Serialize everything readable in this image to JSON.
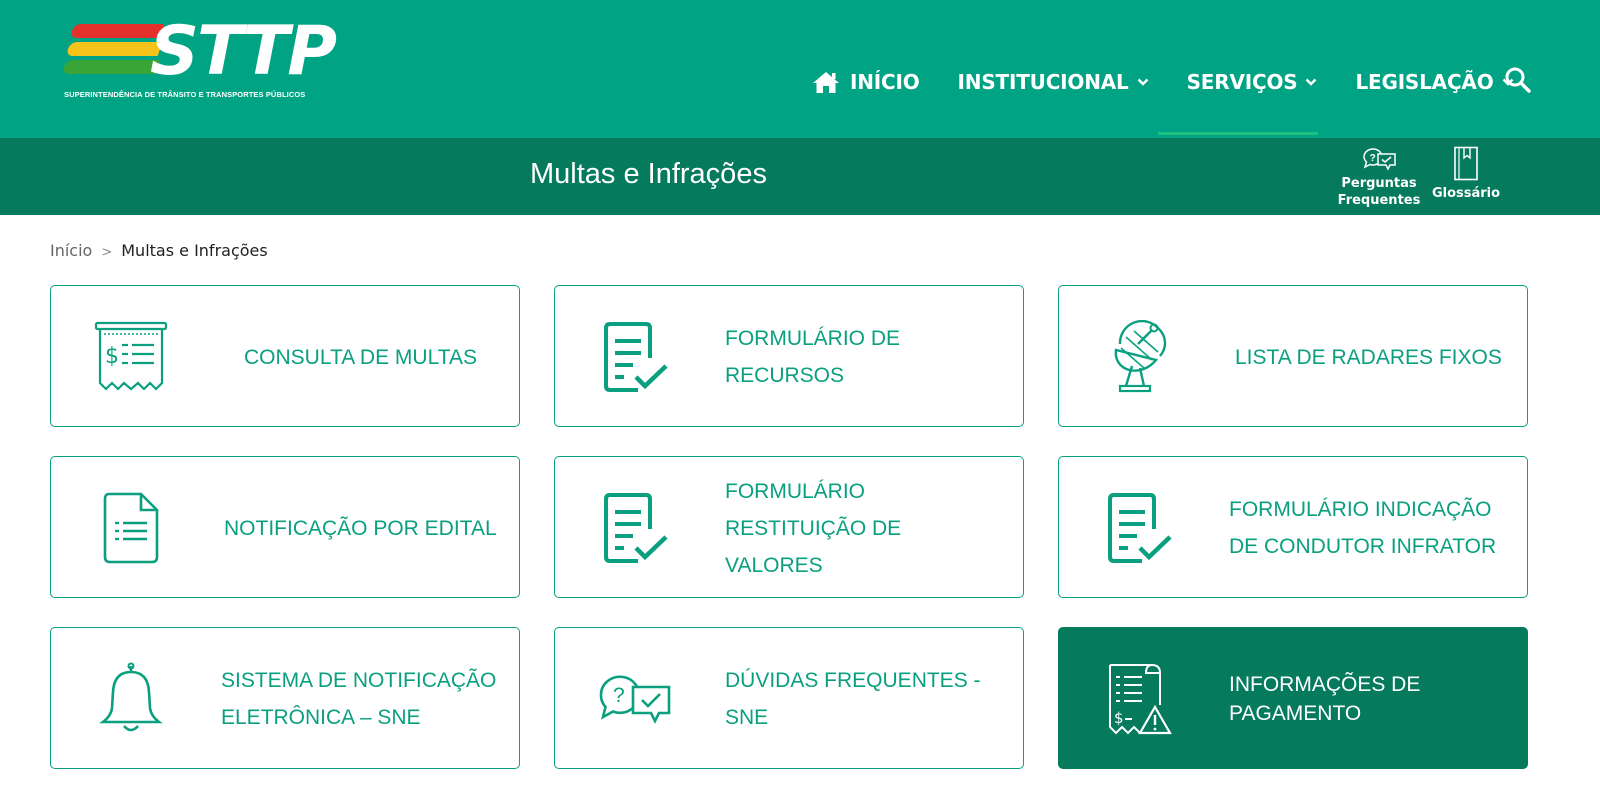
{
  "brand": {
    "logo_text": "STTP",
    "tagline": "SUPERINTENDÊNCIA DE TRÂNSITO E TRANSPORTES PÚBLICOS",
    "colors": {
      "primary": "#00a383",
      "dark": "#057a5d",
      "logo_red": "#e5312b",
      "logo_yellow": "#f6c31a",
      "logo_green": "#3aa537"
    }
  },
  "nav": {
    "items": [
      {
        "label": "INÍCIO",
        "icon": "home-icon"
      },
      {
        "label": "INSTITUCIONAL",
        "icon": "chevron-down-icon"
      },
      {
        "label": "SERVIÇOS",
        "icon": "chevron-down-icon"
      },
      {
        "label": "LEGISLAÇÃO",
        "icon": "chevron-down-icon"
      }
    ],
    "search_icon": "search-icon"
  },
  "titlebar": {
    "title": "Multas e Infrações",
    "faq_line1": "Perguntas",
    "faq_line2": "Frequentes",
    "glossary": "Glossário"
  },
  "breadcrumb": {
    "home": "Início",
    "separator": ">",
    "current": "Multas e Infrações"
  },
  "cards": [
    {
      "label": "CONSULTA DE MULTAS",
      "icon": "receipt-dollar-icon"
    },
    {
      "label": "FORMULÁRIO DE RECURSOS",
      "icon": "form-check-icon"
    },
    {
      "label": "LISTA DE RADARES FIXOS",
      "icon": "radar-dish-icon"
    },
    {
      "label": "NOTIFICAÇÃO POR EDITAL",
      "icon": "document-icon"
    },
    {
      "label": "FORMULÁRIO RESTITUIÇÃO DE VALORES",
      "icon": "form-check-icon"
    },
    {
      "label": "FORMULÁRIO INDICAÇÃO DE CONDUTOR INFRATOR",
      "icon": "form-check-icon"
    },
    {
      "label": "SISTEMA DE NOTIFICAÇÃO ELETRÔNICA – SNE",
      "icon": "bell-icon"
    },
    {
      "label": "DÚVIDAS FREQUENTES - SNE",
      "icon": "chat-question-icon"
    },
    {
      "label": "INFORMAÇÕES DE PAGAMENTO",
      "icon": "receipt-warning-icon"
    }
  ]
}
